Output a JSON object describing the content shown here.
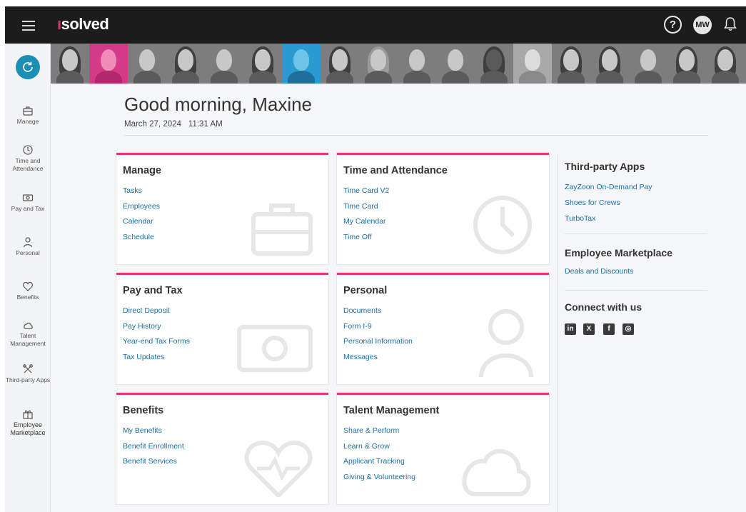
{
  "header": {
    "logo_prefix": "ı",
    "logo_text": "solved",
    "help_label": "?",
    "avatar_initials": "MW"
  },
  "sidebar": {
    "items": [
      {
        "label": "Manage",
        "icon": "briefcase-icon"
      },
      {
        "label": "Time and Attendance",
        "icon": "clock-icon"
      },
      {
        "label": "Pay and Tax",
        "icon": "money-icon"
      },
      {
        "label": "Personal",
        "icon": "person-icon"
      },
      {
        "label": "Benefits",
        "icon": "heart-icon"
      },
      {
        "label": "Talent Management",
        "icon": "cloud-icon"
      },
      {
        "label": "Third-party Apps",
        "icon": "tools-icon"
      },
      {
        "label": "Employee Marketplace",
        "icon": "gift-icon"
      }
    ]
  },
  "main": {
    "greeting": "Good morning, Maxine",
    "date": "March 27, 2024",
    "time": "11:31 AM",
    "cards": [
      {
        "title": "Manage",
        "links": [
          "Tasks",
          "Employees",
          "Calendar",
          "Schedule"
        ]
      },
      {
        "title": "Time and Attendance",
        "links": [
          "Time Card V2",
          "Time Card",
          "My Calendar",
          "Time Off"
        ]
      },
      {
        "title": "Pay and Tax",
        "links": [
          "Direct Deposit",
          "Pay History",
          "Year-end Tax Forms",
          "Tax Updates"
        ]
      },
      {
        "title": "Personal",
        "links": [
          "Documents",
          "Form I-9",
          "Personal Information",
          "Messages"
        ]
      },
      {
        "title": "Benefits",
        "links": [
          "My Benefits",
          "Benefit Enrollment",
          "Benefit Services"
        ]
      },
      {
        "title": "Talent Management",
        "links": [
          "Share & Perform",
          "Learn & Grow",
          "Applicant Tracking",
          "Giving & Volunteering"
        ]
      }
    ]
  },
  "right": {
    "third_party_title": "Third-party Apps",
    "third_party_links": [
      "ZayZoon On-Demand Pay",
      "Shoes for Crews",
      "TurboTax"
    ],
    "marketplace_title": "Employee Marketplace",
    "marketplace_links": [
      "Deals and Discounts"
    ],
    "connect_title": "Connect with us",
    "social": [
      {
        "icon": "linkedin-icon",
        "glyph": "in"
      },
      {
        "icon": "x-icon",
        "glyph": "X"
      },
      {
        "icon": "facebook-icon",
        "glyph": "f"
      },
      {
        "icon": "instagram-icon",
        "glyph": "◎"
      }
    ]
  },
  "colors": {
    "accent": "#e03a7b",
    "link": "#1b6ea8",
    "topbar": "#1c1c1c",
    "home_button": "#1d8fb4"
  }
}
